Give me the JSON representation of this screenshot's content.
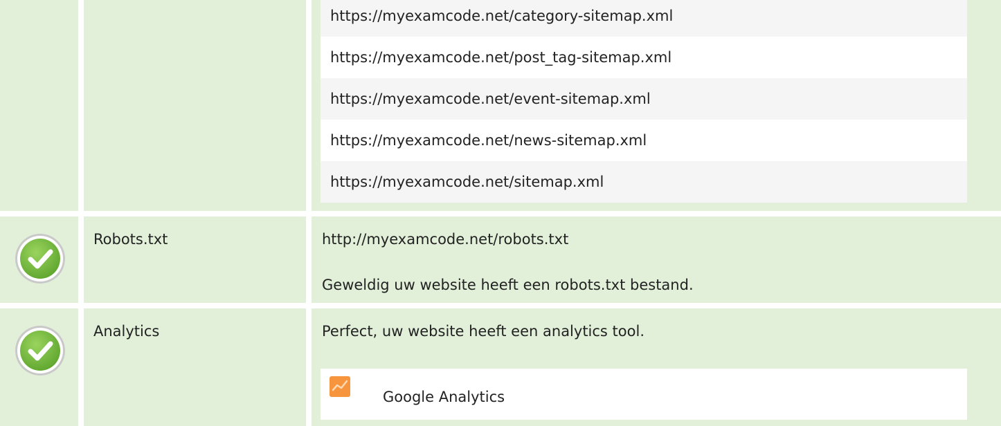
{
  "sitemaps": {
    "items": [
      "https://myexamcode.net/category-sitemap.xml",
      "https://myexamcode.net/post_tag-sitemap.xml",
      "https://myexamcode.net/event-sitemap.xml",
      "https://myexamcode.net/news-sitemap.xml",
      "https://myexamcode.net/sitemap.xml"
    ]
  },
  "robots": {
    "status_icon": "check-circle-icon",
    "label": "Robots.txt",
    "url": "http://myexamcode.net/robots.txt",
    "message": "Geweldig uw website heeft een robots.txt bestand."
  },
  "analytics": {
    "status_icon": "check-circle-icon",
    "label": "Analytics",
    "message": "Perfect, uw website heeft een analytics tool.",
    "tool_icon": "google-analytics-icon",
    "tool_name": "Google Analytics"
  },
  "colors": {
    "row_background": "#e2f0d9",
    "check_green": "#7bc043",
    "list_alt_background": "#f5f5f5",
    "analytics_orange": "#f7943e"
  }
}
